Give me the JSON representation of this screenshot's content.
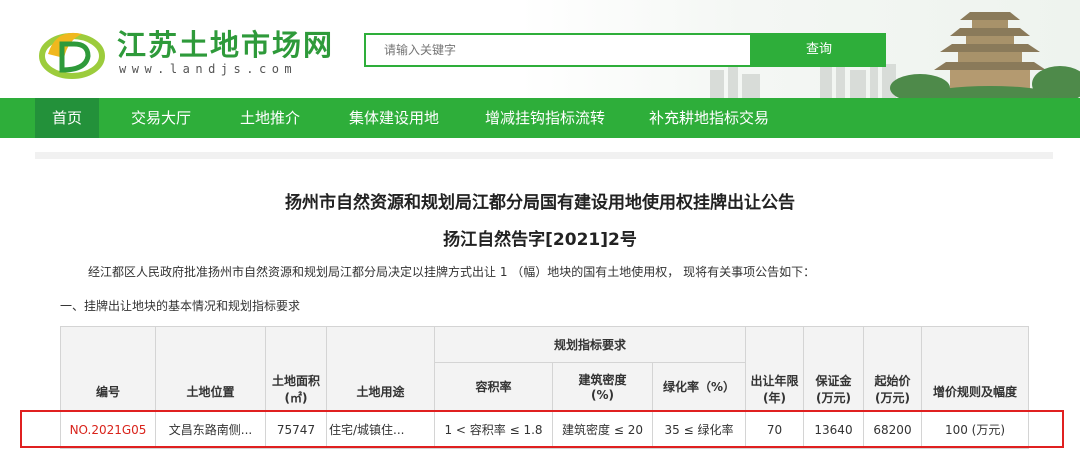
{
  "header": {
    "site_title": "江苏土地市场网",
    "site_url": "www.landjs.com",
    "search_placeholder": "请输入关键字",
    "search_button": "查询"
  },
  "nav": {
    "items": [
      {
        "label": "首页",
        "active": true
      },
      {
        "label": "交易大厅",
        "active": false
      },
      {
        "label": "土地推介",
        "active": false
      },
      {
        "label": "集体建设用地",
        "active": false
      },
      {
        "label": "增减挂钩指标流转",
        "active": false
      },
      {
        "label": "补充耕地指标交易",
        "active": false
      }
    ]
  },
  "article": {
    "title": "扬州市自然资源和规划局江都分局国有建设用地使用权挂牌出让公告",
    "doc_number": "扬江自然告字[2021]2号",
    "intro": "经江都区人民政府批准扬州市自然资源和规划局江都分局决定以挂牌方式出让 1 （幅）地块的国有土地使用权， 现将有关事项公告如下：",
    "section_heading": "一、挂牌出让地块的基本情况和规划指标要求"
  },
  "table": {
    "group_header": "规划指标要求",
    "columns": {
      "id": "编号",
      "location": "土地位置",
      "area": "土地面积\n(㎡)",
      "use": "土地用途",
      "far": "容积率",
      "density": "建筑密度\n(%)",
      "green": "绿化率（%）",
      "years": "出让年限\n(年)",
      "deposit": "保证金\n(万元)",
      "start_price": "起始价\n(万元)",
      "increment": "增价规则及幅度"
    },
    "row": {
      "id": "NO.2021G05",
      "location": "文昌东路南侧...",
      "area": "75747",
      "use": "住宅/城镇住...",
      "far": "1 < 容积率 ≤ 1.8",
      "density": "建筑密度 ≤ 20",
      "green": "35 ≤ 绿化率",
      "years": "70",
      "deposit": "13640",
      "start_price": "68200",
      "increment": "100 (万元)"
    }
  },
  "colors": {
    "brand_green": "#2eae3a",
    "nav_active": "#23913a",
    "highlight_red": "#e02020",
    "id_red": "#d9231b"
  }
}
